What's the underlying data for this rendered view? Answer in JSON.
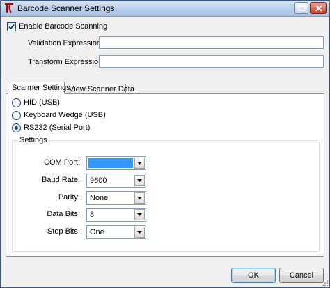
{
  "window": {
    "title": "Barcode Scanner Settings"
  },
  "enable": {
    "label": "Enable Barcode Scanning",
    "checked": true
  },
  "fields": {
    "validation_label": "Validation Expression",
    "validation_value": "",
    "transform_label": "Transform Expression",
    "transform_value": ""
  },
  "tabs": [
    {
      "label": "Scanner Settings",
      "active": true
    },
    {
      "label": "View Scanner Data",
      "active": false
    }
  ],
  "radios": [
    {
      "label": "HID (USB)",
      "selected": false
    },
    {
      "label": "Keyboard Wedge (USB)",
      "selected": false
    },
    {
      "label": "RS232 (Serial Port)",
      "selected": true
    }
  ],
  "settings": {
    "title": "Settings",
    "rows": [
      {
        "label": "COM Port:",
        "value": ""
      },
      {
        "label": "Baud Rate:",
        "value": "9600"
      },
      {
        "label": "Parity:",
        "value": "None"
      },
      {
        "label": "Data Bits:",
        "value": "8"
      },
      {
        "label": "Stop Bits:",
        "value": "One"
      }
    ]
  },
  "buttons": {
    "ok": "OK",
    "cancel": "Cancel"
  },
  "colors": {
    "selection": "#3399ff",
    "titlebar": "#bcd0ea",
    "close": "#c2422c"
  }
}
